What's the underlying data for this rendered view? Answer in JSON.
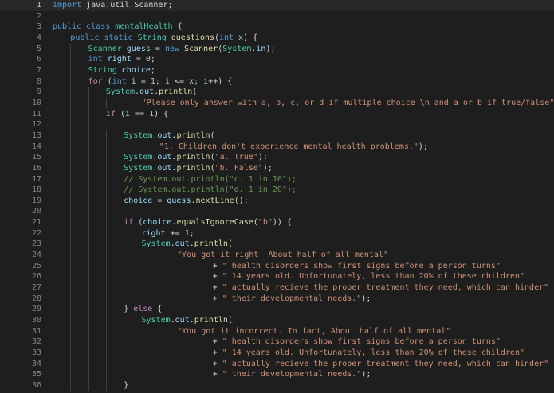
{
  "editor": {
    "lines": [
      {
        "n": "1",
        "indent": 0,
        "tokens": [
          [
            "kw",
            "import"
          ],
          [
            "pl",
            " java.util.Scanner;"
          ]
        ]
      },
      {
        "n": "2",
        "indent": 0,
        "tokens": []
      },
      {
        "n": "3",
        "indent": 0,
        "tokens": [
          [
            "kw",
            "public"
          ],
          [
            "pl",
            " "
          ],
          [
            "kw",
            "class"
          ],
          [
            "pl",
            " "
          ],
          [
            "ty",
            "mentalHealth"
          ],
          [
            "pl",
            " {"
          ]
        ]
      },
      {
        "n": "4",
        "indent": 1,
        "tokens": [
          [
            "kw",
            "public"
          ],
          [
            "pl",
            " "
          ],
          [
            "kw",
            "static"
          ],
          [
            "pl",
            " "
          ],
          [
            "ty",
            "String"
          ],
          [
            "pl",
            " "
          ],
          [
            "fn",
            "questions"
          ],
          [
            "pl",
            "("
          ],
          [
            "kw",
            "int"
          ],
          [
            "pl",
            " "
          ],
          [
            "var",
            "x"
          ],
          [
            "pl",
            ") {"
          ]
        ]
      },
      {
        "n": "5",
        "indent": 2,
        "tokens": [
          [
            "ty",
            "Scanner"
          ],
          [
            "pl",
            " "
          ],
          [
            "var",
            "guess"
          ],
          [
            "pl",
            " = "
          ],
          [
            "kw",
            "new"
          ],
          [
            "pl",
            " "
          ],
          [
            "fn",
            "Scanner"
          ],
          [
            "pl",
            "("
          ],
          [
            "ty",
            "System"
          ],
          [
            "pl",
            "."
          ],
          [
            "var",
            "in"
          ],
          [
            "pl",
            ");"
          ]
        ]
      },
      {
        "n": "6",
        "indent": 2,
        "tokens": [
          [
            "kw",
            "int"
          ],
          [
            "pl",
            " "
          ],
          [
            "var",
            "right"
          ],
          [
            "pl",
            " = "
          ],
          [
            "num",
            "0"
          ],
          [
            "pl",
            ";"
          ]
        ]
      },
      {
        "n": "7",
        "indent": 2,
        "tokens": [
          [
            "ty",
            "String"
          ],
          [
            "pl",
            " "
          ],
          [
            "var",
            "choice"
          ],
          [
            "pl",
            ";"
          ]
        ]
      },
      {
        "n": "8",
        "indent": 2,
        "tokens": [
          [
            "ctl",
            "for"
          ],
          [
            "pl",
            " ("
          ],
          [
            "kw",
            "int"
          ],
          [
            "pl",
            " "
          ],
          [
            "var",
            "i"
          ],
          [
            "pl",
            " = "
          ],
          [
            "num",
            "1"
          ],
          [
            "pl",
            "; "
          ],
          [
            "var",
            "i"
          ],
          [
            "pl",
            " <= "
          ],
          [
            "var",
            "x"
          ],
          [
            "pl",
            "; "
          ],
          [
            "var",
            "i"
          ],
          [
            "pl",
            "++) {"
          ]
        ]
      },
      {
        "n": "9",
        "indent": 3,
        "tokens": [
          [
            "ty",
            "System"
          ],
          [
            "pl",
            "."
          ],
          [
            "var",
            "out"
          ],
          [
            "pl",
            "."
          ],
          [
            "fn",
            "println"
          ],
          [
            "pl",
            "("
          ]
        ]
      },
      {
        "n": "10",
        "indent": 5,
        "tokens": [
          [
            "str",
            "\"Please only answer with a, b, c, or d if multiple choice \\n and a or b if true/false\""
          ],
          [
            "pl",
            ");"
          ]
        ]
      },
      {
        "n": "11",
        "indent": 3,
        "tokens": [
          [
            "ctl",
            "if"
          ],
          [
            "pl",
            " ("
          ],
          [
            "var",
            "i"
          ],
          [
            "pl",
            " == "
          ],
          [
            "num",
            "1"
          ],
          [
            "pl",
            ") {"
          ]
        ]
      },
      {
        "n": "12",
        "indent": 0,
        "tokens": []
      },
      {
        "n": "13",
        "indent": 4,
        "tokens": [
          [
            "ty",
            "System"
          ],
          [
            "pl",
            "."
          ],
          [
            "var",
            "out"
          ],
          [
            "pl",
            "."
          ],
          [
            "fn",
            "println"
          ],
          [
            "pl",
            "("
          ]
        ]
      },
      {
        "n": "14",
        "indent": 6,
        "tokens": [
          [
            "str",
            "\"1. Children don't experience mental health problems.\""
          ],
          [
            "pl",
            ");"
          ]
        ]
      },
      {
        "n": "15",
        "indent": 4,
        "tokens": [
          [
            "ty",
            "System"
          ],
          [
            "pl",
            "."
          ],
          [
            "var",
            "out"
          ],
          [
            "pl",
            "."
          ],
          [
            "fn",
            "println"
          ],
          [
            "pl",
            "("
          ],
          [
            "str",
            "\"a. True\""
          ],
          [
            "pl",
            ");"
          ]
        ]
      },
      {
        "n": "16",
        "indent": 4,
        "tokens": [
          [
            "ty",
            "System"
          ],
          [
            "pl",
            "."
          ],
          [
            "var",
            "out"
          ],
          [
            "pl",
            "."
          ],
          [
            "fn",
            "println"
          ],
          [
            "pl",
            "("
          ],
          [
            "str",
            "\"b. False\""
          ],
          [
            "pl",
            ");"
          ]
        ]
      },
      {
        "n": "17",
        "indent": 4,
        "tokens": [
          [
            "cm",
            "// System.out.println(\"c. 1 in 10\");"
          ]
        ]
      },
      {
        "n": "18",
        "indent": 4,
        "tokens": [
          [
            "cm",
            "// System.out.println(\"d. 1 in 20\");"
          ]
        ]
      },
      {
        "n": "19",
        "indent": 4,
        "tokens": [
          [
            "var",
            "choice"
          ],
          [
            "pl",
            " = "
          ],
          [
            "var",
            "guess"
          ],
          [
            "pl",
            "."
          ],
          [
            "fn",
            "nextLine"
          ],
          [
            "pl",
            "();"
          ]
        ]
      },
      {
        "n": "20",
        "indent": 0,
        "tokens": []
      },
      {
        "n": "21",
        "indent": 4,
        "tokens": [
          [
            "ctl",
            "if"
          ],
          [
            "pl",
            " ("
          ],
          [
            "var",
            "choice"
          ],
          [
            "pl",
            "."
          ],
          [
            "fn",
            "equalsIgnoreCase"
          ],
          [
            "pl",
            "("
          ],
          [
            "str",
            "\"b\""
          ],
          [
            "pl",
            ")) {"
          ]
        ]
      },
      {
        "n": "22",
        "indent": 5,
        "tokens": [
          [
            "var",
            "right"
          ],
          [
            "pl",
            " += "
          ],
          [
            "num",
            "1"
          ],
          [
            "pl",
            ";"
          ]
        ]
      },
      {
        "n": "23",
        "indent": 5,
        "tokens": [
          [
            "ty",
            "System"
          ],
          [
            "pl",
            "."
          ],
          [
            "var",
            "out"
          ],
          [
            "pl",
            "."
          ],
          [
            "fn",
            "println"
          ],
          [
            "pl",
            "("
          ]
        ]
      },
      {
        "n": "24",
        "indent": 7,
        "tokens": [
          [
            "str",
            "\"You got it right! About half of all mental\""
          ]
        ]
      },
      {
        "n": "25",
        "indent": 9,
        "tokens": [
          [
            "pl",
            "+ "
          ],
          [
            "str",
            "\" health disorders show first signs before a person turns\""
          ]
        ]
      },
      {
        "n": "26",
        "indent": 9,
        "tokens": [
          [
            "pl",
            "+ "
          ],
          [
            "str",
            "\" 14 years old. Unfortunately, less than 20% of these children\""
          ]
        ]
      },
      {
        "n": "27",
        "indent": 9,
        "tokens": [
          [
            "pl",
            "+ "
          ],
          [
            "str",
            "\" actually recieve the proper treatment they need, which can hinder\""
          ]
        ]
      },
      {
        "n": "28",
        "indent": 9,
        "tokens": [
          [
            "pl",
            "+ "
          ],
          [
            "str",
            "\" their developmental needs.\""
          ],
          [
            "pl",
            ");"
          ]
        ]
      },
      {
        "n": "29",
        "indent": 4,
        "tokens": [
          [
            "pl",
            "} "
          ],
          [
            "ctl",
            "else"
          ],
          [
            "pl",
            " {"
          ]
        ]
      },
      {
        "n": "30",
        "indent": 5,
        "tokens": [
          [
            "ty",
            "System"
          ],
          [
            "pl",
            "."
          ],
          [
            "var",
            "out"
          ],
          [
            "pl",
            "."
          ],
          [
            "fn",
            "println"
          ],
          [
            "pl",
            "("
          ]
        ]
      },
      {
        "n": "31",
        "indent": 7,
        "tokens": [
          [
            "str",
            "\"You got it incorrect. In fact, About half of all mental\""
          ]
        ]
      },
      {
        "n": "32",
        "indent": 9,
        "tokens": [
          [
            "pl",
            "+ "
          ],
          [
            "str",
            "\" health disorders show first signs before a person turns\""
          ]
        ]
      },
      {
        "n": "33",
        "indent": 9,
        "tokens": [
          [
            "pl",
            "+ "
          ],
          [
            "str",
            "\" 14 years old. Unfortunately, less than 20% of these children\""
          ]
        ]
      },
      {
        "n": "34",
        "indent": 9,
        "tokens": [
          [
            "pl",
            "+ "
          ],
          [
            "str",
            "\" actually recieve the proper treatment they need, which can hinder\""
          ]
        ]
      },
      {
        "n": "35",
        "indent": 9,
        "tokens": [
          [
            "pl",
            "+ "
          ],
          [
            "str",
            "\" their developmental needs.\""
          ],
          [
            "pl",
            ");"
          ]
        ]
      },
      {
        "n": "36",
        "indent": 4,
        "tokens": [
          [
            "pl",
            "}"
          ]
        ]
      }
    ]
  },
  "colors": {
    "background": "#1e1e1e",
    "keyword": "#569cd6",
    "control": "#c586c0",
    "type": "#4ec9b0",
    "function": "#dcdcaa",
    "string": "#ce9178",
    "number": "#b5cea8",
    "comment": "#6a9955",
    "variable": "#9cdcfe"
  }
}
